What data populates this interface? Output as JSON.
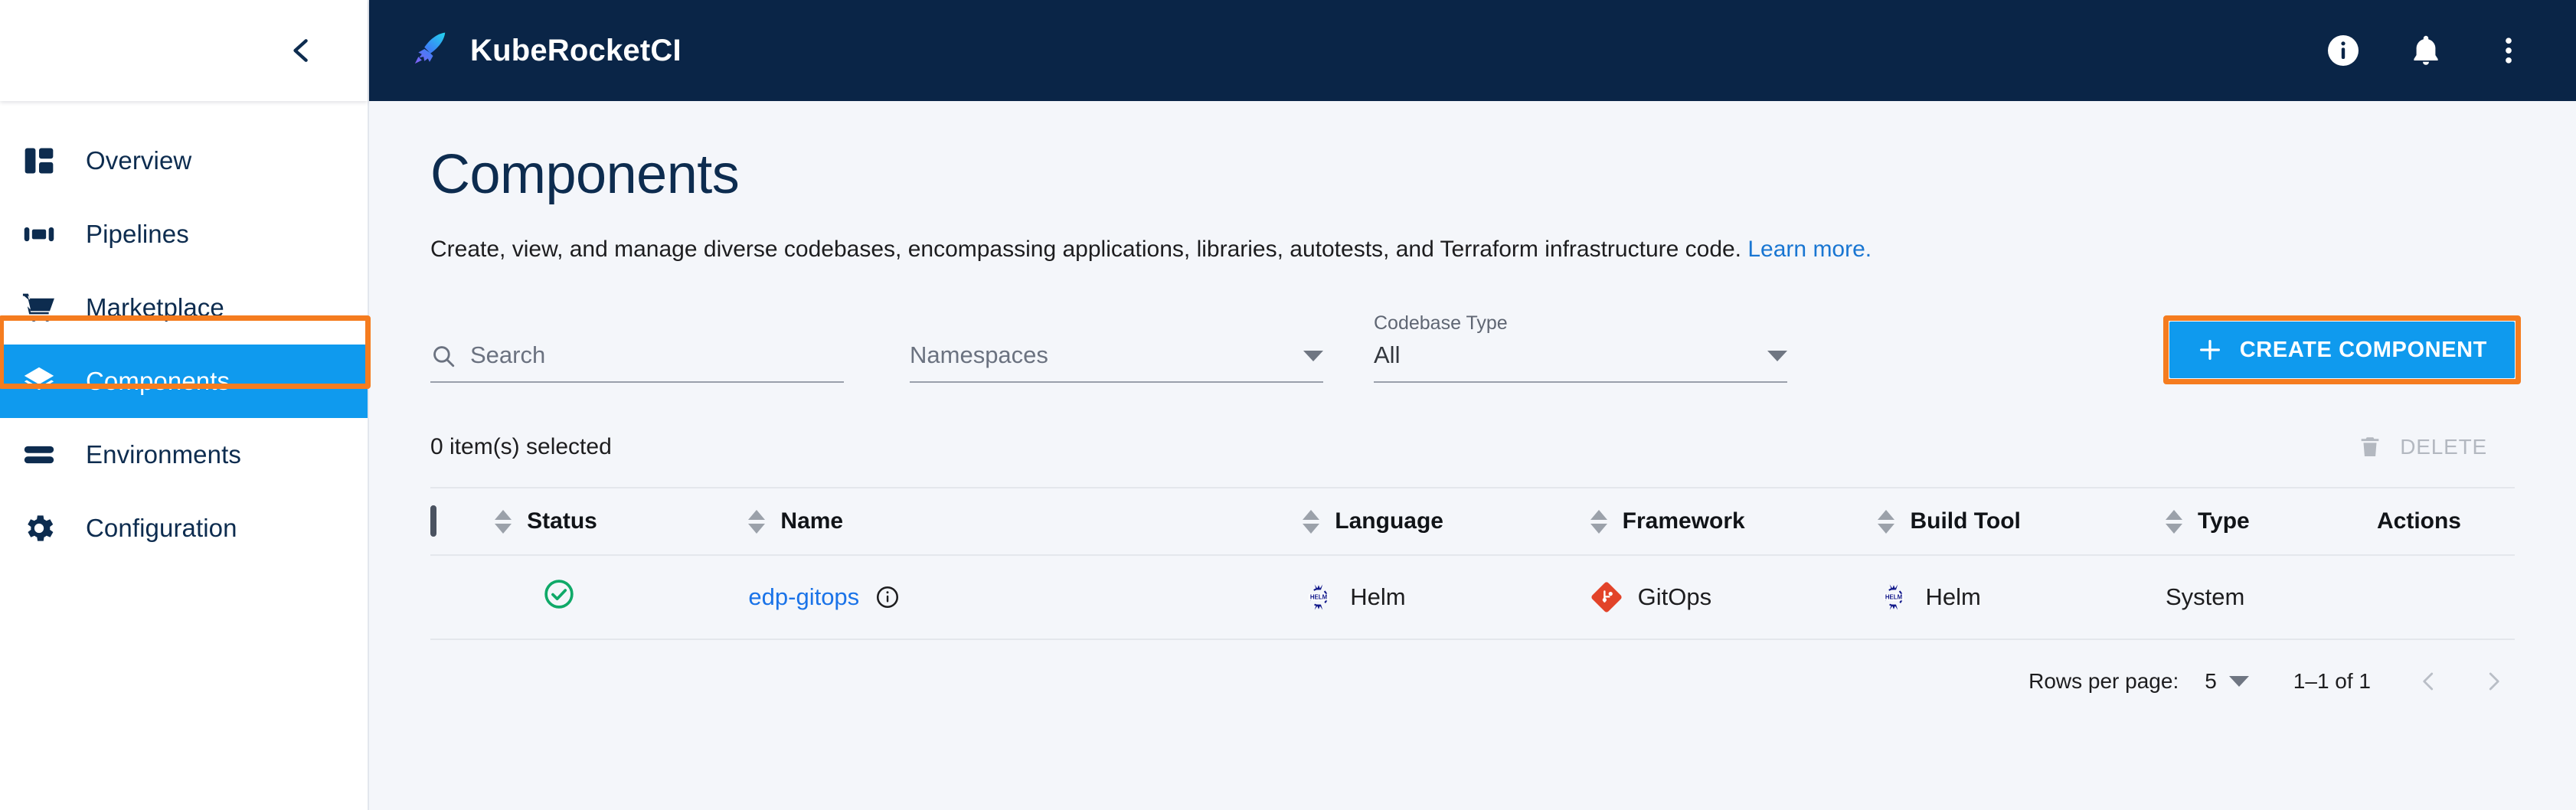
{
  "sidebar": {
    "collapse_icon": "chevron-left-icon",
    "items": [
      {
        "label": "Overview",
        "icon": "dashboard-icon",
        "active": false
      },
      {
        "label": "Pipelines",
        "icon": "pipelines-icon",
        "active": false
      },
      {
        "label": "Marketplace",
        "icon": "cart-icon",
        "active": false
      },
      {
        "label": "Components",
        "icon": "layers-icon",
        "active": true
      },
      {
        "label": "Environments",
        "icon": "stack-icon",
        "active": false
      },
      {
        "label": "Configuration",
        "icon": "gear-icon",
        "active": false
      }
    ]
  },
  "topbar": {
    "brand": "KubeRocketCI",
    "logo_icon": "rocket-icon",
    "icons": [
      {
        "name": "info-icon"
      },
      {
        "name": "bell-icon"
      },
      {
        "name": "more-vertical-icon"
      }
    ]
  },
  "page": {
    "title": "Components",
    "description": "Create, view, and manage diverse codebases, encompassing applications, libraries, autotests, and Terraform infrastructure code.",
    "learn_more": "Learn more."
  },
  "filters": {
    "search": {
      "placeholder": "Search",
      "value": "",
      "icon": "search-icon"
    },
    "namespaces": {
      "label": "",
      "value": "Namespaces",
      "icon": "chevron-down-icon"
    },
    "codebase_type": {
      "label": "Codebase Type",
      "value": "All",
      "icon": "chevron-down-icon"
    }
  },
  "actions": {
    "create_label": "CREATE COMPONENT",
    "create_icon": "plus-icon",
    "highlight_color": "#f57c1f",
    "accent_color": "#0f9aee"
  },
  "toolbar": {
    "selected_text": "0 item(s) selected",
    "delete_label": "DELETE",
    "delete_icon": "trash-icon"
  },
  "table": {
    "select_all_checkbox": "checkbox-unchecked",
    "columns": [
      {
        "label": "Status",
        "sortable": true
      },
      {
        "label": "Name",
        "sortable": true
      },
      {
        "label": "Language",
        "sortable": true
      },
      {
        "label": "Framework",
        "sortable": true
      },
      {
        "label": "Build Tool",
        "sortable": true
      },
      {
        "label": "Type",
        "sortable": true
      },
      {
        "label": "Actions",
        "sortable": false
      }
    ],
    "rows": [
      {
        "status": "ok",
        "status_icon": "check-circle-icon",
        "status_color": "#0fa968",
        "name": "edp-gitops",
        "name_info_icon": "info-outline-icon",
        "language": "Helm",
        "language_icon": "helm-icon",
        "framework": "GitOps",
        "framework_icon": "git-icon",
        "build_tool": "Helm",
        "build_tool_icon": "helm-icon",
        "type": "System",
        "actions": ""
      }
    ]
  },
  "pagination": {
    "rows_per_page_label": "Rows per page:",
    "rows_per_page_value": "5",
    "range": "1–1 of 1",
    "prev_icon": "chevron-left-icon",
    "next_icon": "chevron-right-icon"
  }
}
